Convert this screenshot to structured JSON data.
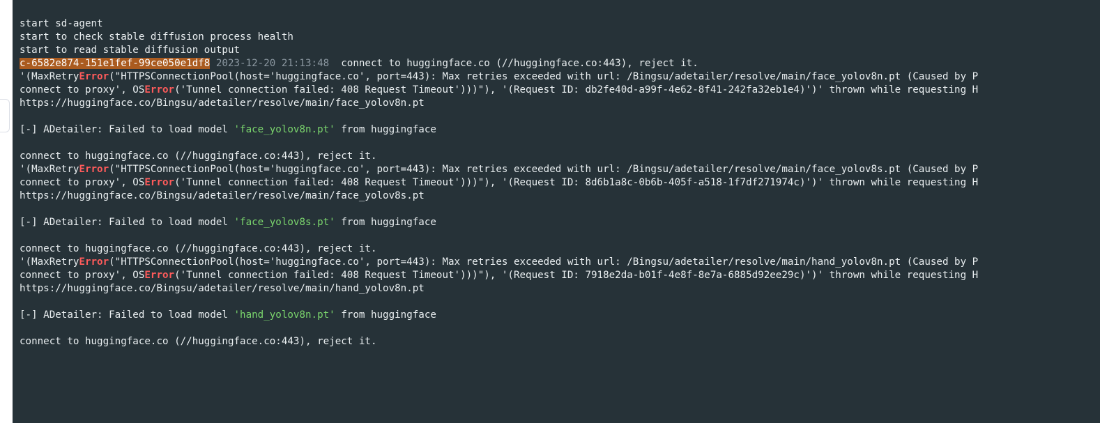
{
  "lines": {
    "l0": "start sd-agent",
    "l1": "start to check stable diffusion process health",
    "l2": "start to read stable diffusion output",
    "l3_id": "c-6582e874-151e1fef-99ce050e1df8",
    "l3_sp": " ",
    "l3_ts": "2023-12-20 21:13:48",
    "l3_rest": "  connect to huggingface.co (//huggingface.co:443), reject it.",
    "l4_a": "'(MaxRetry",
    "err": "Error",
    "l4_b": "(\"HTTPSConnectionPool(host='huggingface.co', port=443): Max retries exceeded with url: /Bingsu/adetailer/resolve/main/face_yolov8n.pt (Caused by P",
    "l5_a": "connect to proxy', OS",
    "l5_b": "('Tunnel connection failed: 408 Request Timeout')))\"), '(Request ID: db2fe40d-a99f-4e62-8f41-242fa32eb1e4)')' thrown while requesting H",
    "l6": "https://huggingface.co/Bingsu/adetailer/resolve/main/face_yolov8n.pt",
    "blank": " ",
    "l8_a": "[-] ADetailer: Failed to load model ",
    "l8_m": "'face_yolov8n.pt'",
    "l8_b": " from huggingface",
    "l10": "connect to huggingface.co (//huggingface.co:443), reject it.",
    "l11_b": "(\"HTTPSConnectionPool(host='huggingface.co', port=443): Max retries exceeded with url: /Bingsu/adetailer/resolve/main/face_yolov8s.pt (Caused by P",
    "l12_b": "('Tunnel connection failed: 408 Request Timeout')))\"), '(Request ID: 8d6b1a8c-0b6b-405f-a518-1f7df271974c)')' thrown while requesting H",
    "l13": "https://huggingface.co/Bingsu/adetailer/resolve/main/face_yolov8s.pt",
    "l15_m": "'face_yolov8s.pt'",
    "l18_b": "(\"HTTPSConnectionPool(host='huggingface.co', port=443): Max retries exceeded with url: /Bingsu/adetailer/resolve/main/hand_yolov8n.pt (Caused by P",
    "l19_b": "('Tunnel connection failed: 408 Request Timeout')))\"), '(Request ID: 7918e2da-b01f-4e8f-8e7a-6885d92ee29c)')' thrown while requesting H",
    "l20": "https://huggingface.co/Bingsu/adetailer/resolve/main/hand_yolov8n.pt",
    "l22_m": "'hand_yolov8n.pt'"
  }
}
